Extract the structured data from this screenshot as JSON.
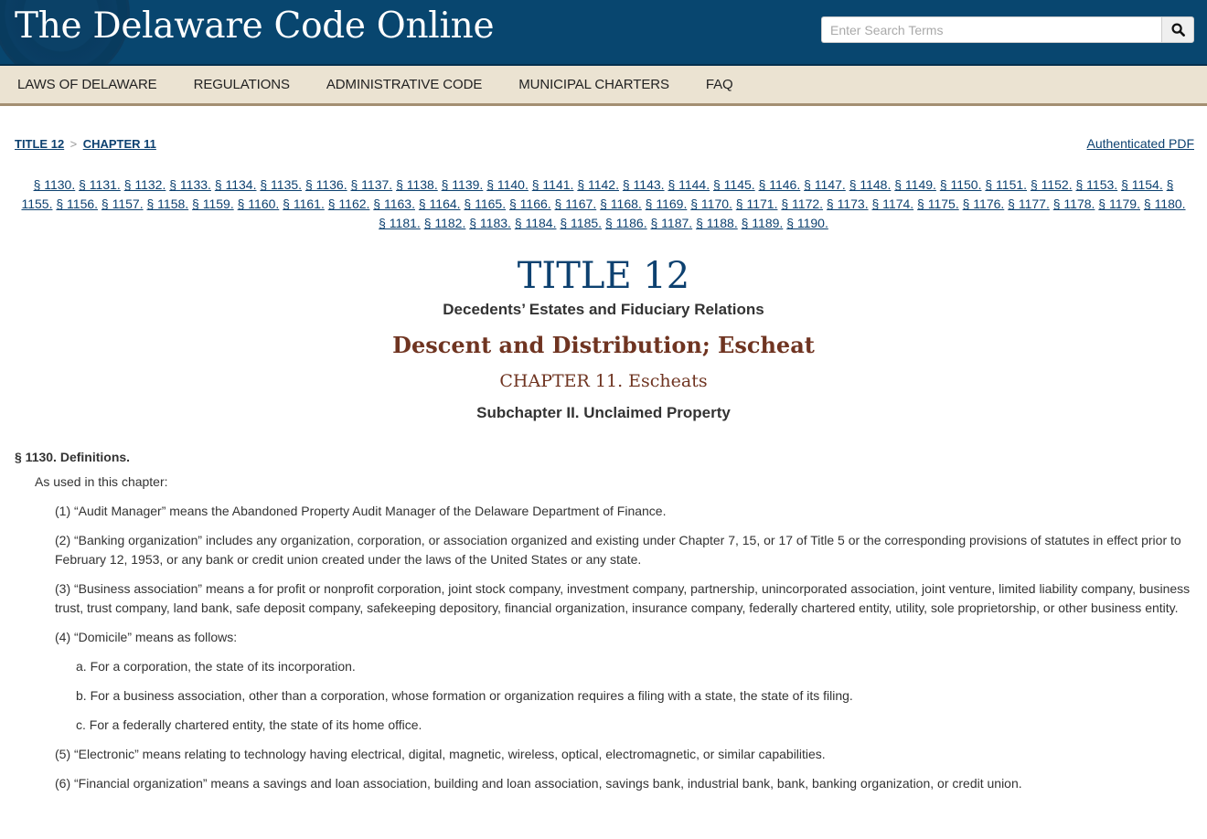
{
  "header": {
    "site_title": "The Delaware Code Online",
    "search_placeholder": "Enter Search Terms",
    "search_value": "",
    "search_icon": "magnifier-icon"
  },
  "nav": {
    "items": [
      {
        "label": "LAWS OF DELAWARE"
      },
      {
        "label": "REGULATIONS"
      },
      {
        "label": "ADMINISTRATIVE CODE"
      },
      {
        "label": "MUNICIPAL CHARTERS"
      },
      {
        "label": "FAQ"
      }
    ]
  },
  "breadcrumb": {
    "items": [
      {
        "label": "TITLE 12"
      },
      {
        "label": "CHAPTER 11"
      }
    ],
    "separator": ">"
  },
  "authenticated_pdf": "Authenticated PDF",
  "section_links": [
    "§ 1130.",
    "§ 1131.",
    "§ 1132.",
    "§ 1133.",
    "§ 1134.",
    "§ 1135.",
    "§ 1136.",
    "§ 1137.",
    "§ 1138.",
    "§ 1139.",
    "§ 1140.",
    "§ 1141.",
    "§ 1142.",
    "§ 1143.",
    "§ 1144.",
    "§ 1145.",
    "§ 1146.",
    "§ 1147.",
    "§ 1148.",
    "§ 1149.",
    "§ 1150.",
    "§ 1151.",
    "§ 1152.",
    "§ 1153.",
    "§ 1154.",
    "§ 1155.",
    "§ 1156.",
    "§ 1157.",
    "§ 1158.",
    "§ 1159.",
    "§ 1160.",
    "§ 1161.",
    "§ 1162.",
    "§ 1163.",
    "§ 1164.",
    "§ 1165.",
    "§ 1166.",
    "§ 1167.",
    "§ 1168.",
    "§ 1169.",
    "§ 1170.",
    "§ 1171.",
    "§ 1172.",
    "§ 1173.",
    "§ 1174.",
    "§ 1175.",
    "§ 1176.",
    "§ 1177.",
    "§ 1178.",
    "§ 1179.",
    "§ 1180.",
    "§ 1181.",
    "§ 1182.",
    "§ 1183.",
    "§ 1184.",
    "§ 1185.",
    "§ 1186.",
    "§ 1187.",
    "§ 1188.",
    "§ 1189.",
    "§ 1190."
  ],
  "titles": {
    "title": "TITLE 12",
    "title_desc": "Decedents’ Estates and Fiduciary Relations",
    "part": "Descent and Distribution; Escheat",
    "chapter": "CHAPTER 11. Escheats",
    "subchapter": "Subchapter II. Unclaimed Property"
  },
  "section": {
    "heading": "§ 1130. Definitions.",
    "intro": "As used in this chapter:",
    "paragraphs": [
      {
        "level": 2,
        "text": "(1) “Audit Manager” means the Abandoned Property Audit Manager of the Delaware Department of Finance."
      },
      {
        "level": 2,
        "text": "(2) “Banking organization” includes any organization, corporation, or association organized and existing under Chapter 7, 15, or 17 of Title 5 or the corresponding provisions of statutes in effect prior to February 12, 1953, or any bank or credit union created under the laws of the United States or any state."
      },
      {
        "level": 2,
        "text": "(3) “Business association” means a for profit or nonprofit corporation, joint stock company, investment company, partnership, unincorporated association, joint venture, limited liability company, business trust, trust company, land bank, safe deposit company, safekeeping depository, financial organization, insurance company, federally chartered entity, utility, sole proprietorship, or other business entity."
      },
      {
        "level": 2,
        "text": "(4) “Domicile” means as follows:"
      },
      {
        "level": 3,
        "text": "a. For a corporation, the state of its incorporation."
      },
      {
        "level": 3,
        "text": "b. For a business association, other than a corporation, whose formation or organization requires a filing with a state, the state of its filing."
      },
      {
        "level": 3,
        "text": "c. For a federally chartered entity, the state of its home office."
      },
      {
        "level": 2,
        "text": "(5) “Electronic” means relating to technology having electrical, digital, magnetic, wireless, optical, electromagnetic, or similar capabilities."
      },
      {
        "level": 2,
        "text": "(6) “Financial organization” means a savings and loan association, building and loan association, savings bank, industrial bank, bank, banking organization, or credit union."
      }
    ]
  }
}
